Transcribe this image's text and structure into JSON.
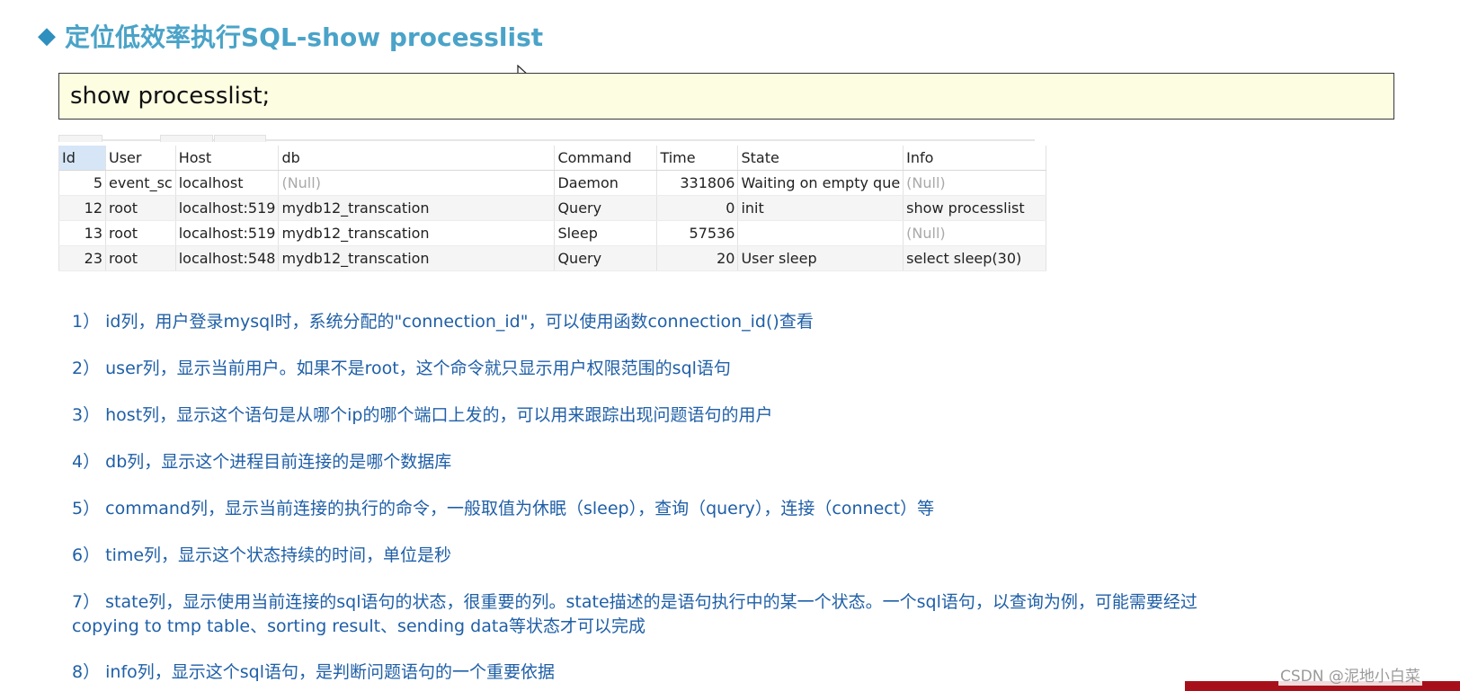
{
  "title": {
    "bullet": "◆",
    "text": "定位低效率执行SQL-show processlist"
  },
  "code": "show processlist;",
  "table": {
    "columns": [
      "Id",
      "User",
      "Host",
      "db",
      "Command",
      "Time",
      "State",
      "Info"
    ],
    "rows": [
      [
        "5",
        "event_sc",
        "localhost",
        "(Null)",
        "Daemon",
        "331806",
        "Waiting on empty que",
        "(Null)"
      ],
      [
        "12",
        "root",
        "localhost:519",
        "mydb12_transcation",
        "Query",
        "0",
        "init",
        "show processlist"
      ],
      [
        "13",
        "root",
        "localhost:519",
        "mydb12_transcation",
        "Sleep",
        "57536",
        "",
        "(Null)"
      ],
      [
        "23",
        "root",
        "localhost:548",
        "mydb12_transcation",
        "Query",
        "20",
        "User sleep",
        "select sleep(30)"
      ]
    ]
  },
  "notes": [
    {
      "text": "1） id列，用户登录mysql时，系统分配的\"connection_id\"，可以使用函数connection_id()查看"
    },
    {
      "text": "2） user列，显示当前用户。如果不是root，这个命令就只显示用户权限范围的sql语句"
    },
    {
      "text": "3） host列，显示这个语句是从哪个ip的哪个端口上发的，可以用来跟踪出现问题语句的用户"
    },
    {
      "text": "4） db列，显示这个进程目前连接的是哪个数据库"
    },
    {
      "text": "5） command列，显示当前连接的执行的命令，一般取值为休眠（sleep），查询（query），连接（connect）等"
    },
    {
      "text": "6） time列，显示这个状态持续的时间，单位是秒"
    },
    {
      "text": "7） state列，显示使用当前连接的sql语句的状态，很重要的列。state描述的是语句执行中的某一个状态。一个sql语句，以查询为例，可能需要经过",
      "line2": "copying to tmp table、sorting result、sending data等状态才可以完成"
    },
    {
      "text": "8） info列，显示这个sql语句，是判断问题语句的一个重要依据"
    }
  ],
  "watermark": "CSDN @泥地小白菜",
  "colors": {
    "title": "#4aa3c8",
    "notes": "#1f5fa7",
    "code_bg": "#fdfde2",
    "null_text": "#a9a9a9",
    "brand_bar": "#a7101a"
  }
}
